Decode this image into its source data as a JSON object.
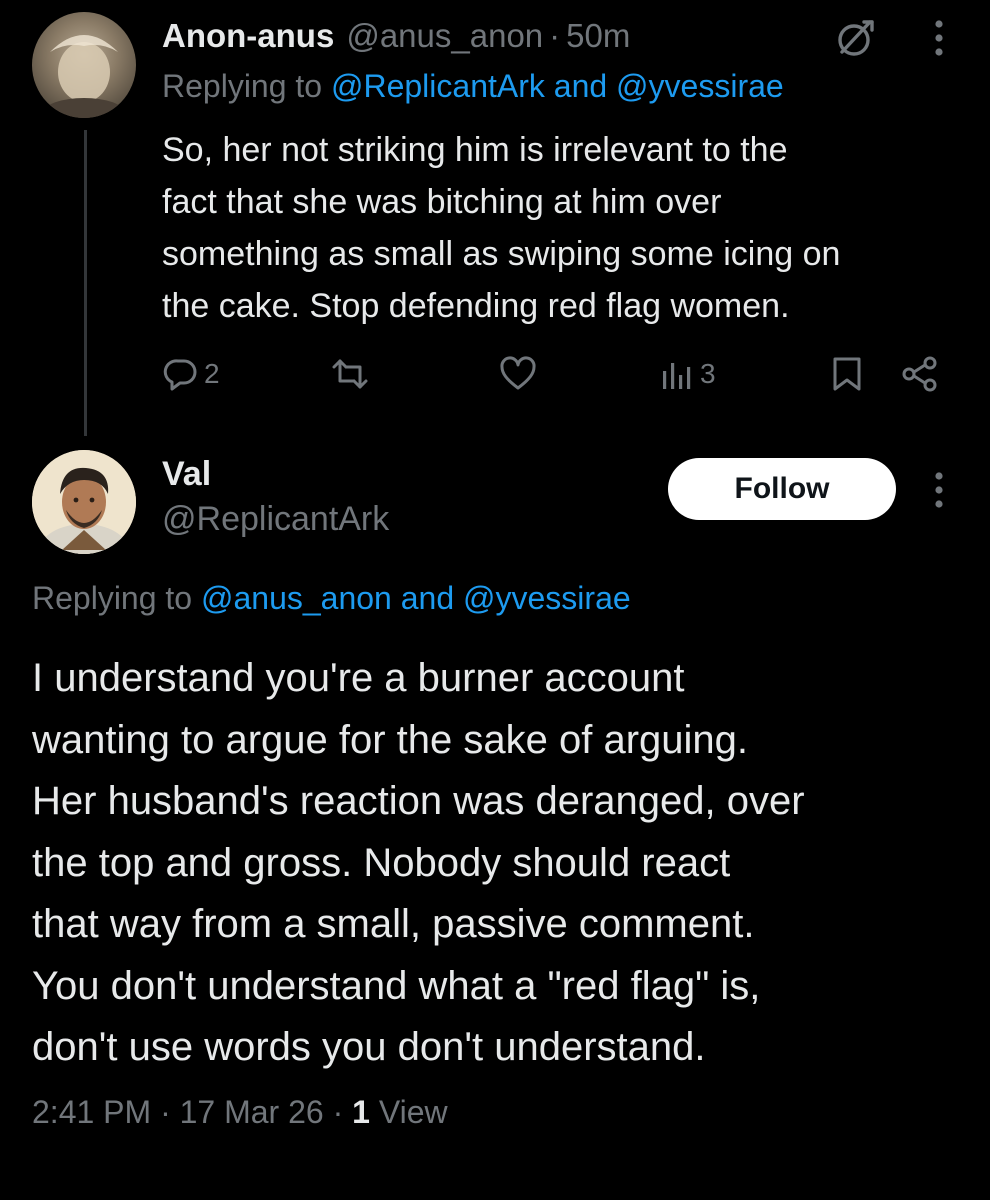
{
  "parent_tweet": {
    "display_name": "Anon-anus",
    "handle": "@anus_anon",
    "time_ago": "50m",
    "replying_prefix": "Replying to",
    "replying_mention_1": "@ReplicantArk",
    "replying_and": "and",
    "replying_mention_2": "@yvessirae",
    "body_lines": [
      "So, her not striking him is irrelevant to the",
      "fact that she was bitching at him over",
      "something as small as swiping some icing on",
      "the cake. Stop defending red flag women."
    ],
    "reply_count": "2",
    "view_count": "3",
    "icons": {
      "grok": "grok-icon",
      "more": "more-vertical-icon",
      "reply": "reply-icon",
      "retweet": "retweet-icon",
      "like": "heart-icon",
      "views": "analytics-icon",
      "bookmark": "bookmark-icon",
      "share": "share-icon"
    }
  },
  "focused_tweet": {
    "display_name": "Val",
    "handle": "@ReplicantArk",
    "follow_label": "Follow",
    "replying_prefix": "Replying to",
    "replying_mention_1": "@anus_anon",
    "replying_and": "and",
    "replying_mention_2": "@yvessirae",
    "body_lines": [
      "I understand you're a burner account",
      "wanting to argue for the sake of arguing.",
      "Her husband's reaction was deranged, over",
      "the top and gross. Nobody should react",
      "that way from a small, passive comment.",
      "You don't understand what a \"red flag\" is,",
      "don't use words you don't understand."
    ],
    "time": "2:41 PM",
    "date": "17 Mar 26",
    "views_count": "1",
    "views_label": "View"
  },
  "colors": {
    "background": "#000000",
    "text_primary": "#e7e9ea",
    "text_secondary": "#71767b",
    "accent_link": "#1d9bf0",
    "follow_bg": "#ffffff",
    "follow_text": "#0f1419"
  }
}
